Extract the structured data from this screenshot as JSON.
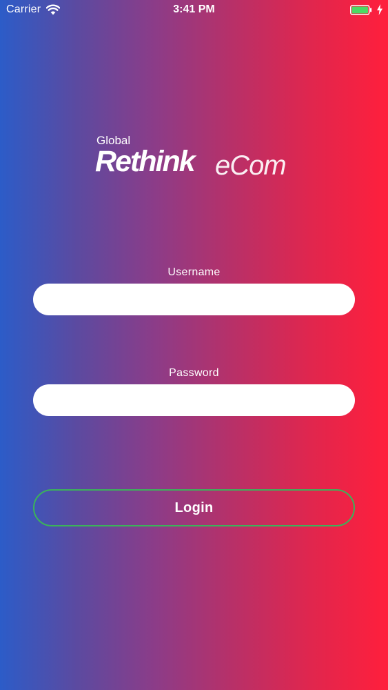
{
  "status_bar": {
    "carrier": "Carrier",
    "time": "3:41 PM",
    "battery_color": "#4cd964"
  },
  "logo": {
    "line1": "Global",
    "brand": "Rethink",
    "suffix": "eCom"
  },
  "form": {
    "username_label": "Username",
    "username_value": "",
    "password_label": "Password",
    "password_value": "",
    "login_label": "Login"
  },
  "colors": {
    "gradient_left": "#2c5cc8",
    "gradient_right": "#ff1f3c",
    "login_border": "#3bb35a"
  }
}
